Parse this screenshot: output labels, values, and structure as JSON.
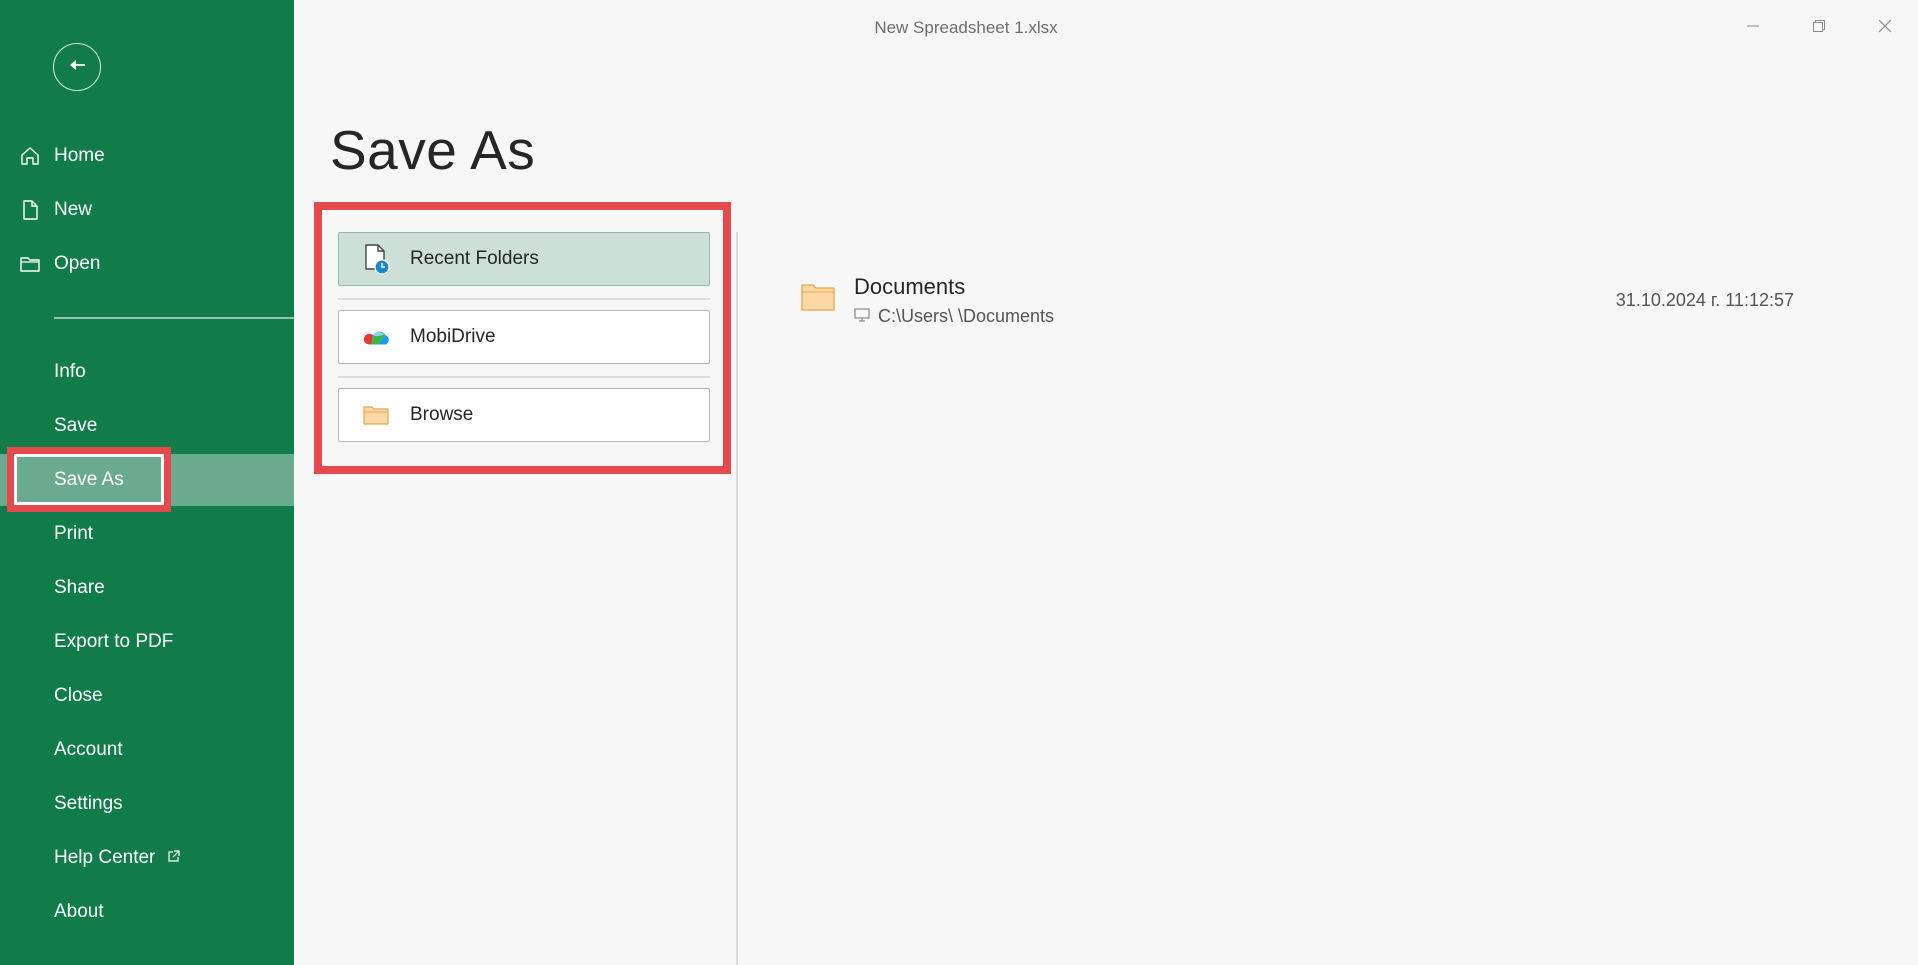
{
  "window": {
    "title": "New Spreadsheet 1.xlsx",
    "controls": [
      "minimize-icon",
      "restore-icon",
      "close-icon"
    ]
  },
  "sidebar": {
    "background_color": "#107c4a",
    "active_color": "#6aab8f",
    "back_icon": "arrow-left-icon",
    "items": [
      {
        "label": "Home",
        "icon": "home-icon"
      },
      {
        "label": "New",
        "icon": "new-file-icon"
      },
      {
        "label": "Open",
        "icon": "folder-open-icon"
      },
      {
        "label": "Info"
      },
      {
        "label": "Save"
      },
      {
        "label": "Save As",
        "active": true
      },
      {
        "label": "Print"
      },
      {
        "label": "Share"
      },
      {
        "label": "Export to PDF"
      },
      {
        "label": "Close"
      },
      {
        "label": "Account"
      },
      {
        "label": "Settings"
      },
      {
        "label": "Help Center",
        "icon": "external-link-icon"
      },
      {
        "label": "About"
      }
    ]
  },
  "main": {
    "title": "Save As",
    "highlight_color": "#e5484d",
    "locations": [
      {
        "label": "Recent Folders",
        "icon": "recent-file-icon",
        "selected": true
      },
      {
        "label": "MobiDrive",
        "icon": "mobidrive-icon"
      },
      {
        "label": "Browse",
        "icon": "folder-icon"
      }
    ],
    "recent_folders": [
      {
        "name": "Documents",
        "path": "C:\\Users\\        \\Documents",
        "date": "31.10.2024 г. 11:12:57",
        "icon": "folder-icon"
      }
    ]
  }
}
